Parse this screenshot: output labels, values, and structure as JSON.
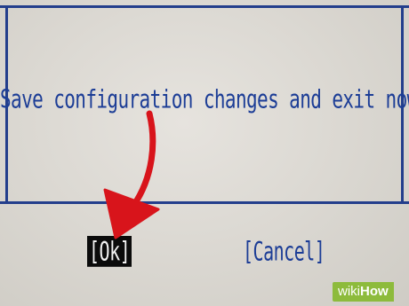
{
  "dialog": {
    "prompt": "Save configuration changes and exit now?",
    "ok_label": "[Ok]",
    "cancel_label": "[Cancel]",
    "text_color": "#1c3d96",
    "selected_bg": "#0b0b0b"
  },
  "annotation": {
    "arrow_color": "#d8141b",
    "icon": "red-arrow-pointer"
  },
  "watermark": {
    "part1": "wiki",
    "part2": "How",
    "bg_color": "#8dbb3c"
  }
}
